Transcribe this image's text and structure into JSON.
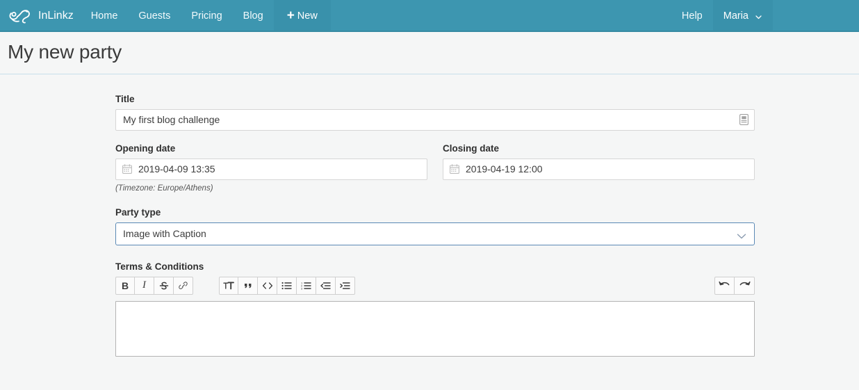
{
  "navbar": {
    "brand": {
      "label": "InLinkz",
      "logo_icon": "frog-logo-icon"
    },
    "items": [
      {
        "label": "Home",
        "name": "home"
      },
      {
        "label": "Guests",
        "name": "guests"
      },
      {
        "label": "Pricing",
        "name": "pricing"
      },
      {
        "label": "Blog",
        "name": "blog"
      }
    ],
    "new_button": {
      "label": "New",
      "plus": "+"
    },
    "help": {
      "label": "Help"
    },
    "user": {
      "label": "Maria",
      "caret_icon": "chevron-down-icon"
    },
    "background_color": "#3d96b0",
    "active_color": "#3991ab"
  },
  "page": {
    "title": "My new party",
    "divider_color": "#c7dfea",
    "background_color": "#f5f6f6"
  },
  "form": {
    "title_field": {
      "label": "Title",
      "value": "My first blog challenge",
      "placeholder": "Title",
      "icon": "id-card-icon"
    },
    "opening_date": {
      "label": "Opening date",
      "value": "2019-04-09 13:35",
      "placeholder": "Opening date",
      "icon": "calendar-icon"
    },
    "closing_date": {
      "label": "Closing date",
      "value": "2019-04-19 12:00",
      "placeholder": "Closing date",
      "icon": "calendar-icon"
    },
    "timezone_note": "(Timezone: Europe/Athens)",
    "party_type": {
      "label": "Party type",
      "value": "Image with Caption",
      "chevron_icon": "chevron-down-icon",
      "focus_border_color": "#5a89b5"
    },
    "terms": {
      "label": "Terms & Conditions",
      "content": "",
      "placeholder": "",
      "toolbar": {
        "group_format": [
          {
            "name": "bold-button",
            "label": "B",
            "icon": "bold-icon"
          },
          {
            "name": "italic-button",
            "label": "I",
            "icon": "italic-icon"
          },
          {
            "name": "strikethrough-button",
            "label": "S",
            "icon": "strikethrough-icon"
          },
          {
            "name": "link-button",
            "label": "",
            "icon": "link-icon"
          }
        ],
        "group_block": [
          {
            "name": "text-size-button",
            "label": "",
            "icon": "text-size-icon"
          },
          {
            "name": "blockquote-button",
            "label": "",
            "icon": "quote-icon"
          },
          {
            "name": "code-button",
            "label": "",
            "icon": "code-icon"
          },
          {
            "name": "bullet-list-button",
            "label": "",
            "icon": "bullet-list-icon"
          },
          {
            "name": "numbered-list-button",
            "label": "",
            "icon": "numbered-list-icon"
          },
          {
            "name": "outdent-button",
            "label": "",
            "icon": "outdent-icon"
          },
          {
            "name": "indent-button",
            "label": "",
            "icon": "indent-icon"
          }
        ],
        "group_history": [
          {
            "name": "undo-button",
            "label": "",
            "icon": "undo-icon"
          },
          {
            "name": "redo-button",
            "label": "",
            "icon": "redo-icon"
          }
        ]
      }
    }
  }
}
